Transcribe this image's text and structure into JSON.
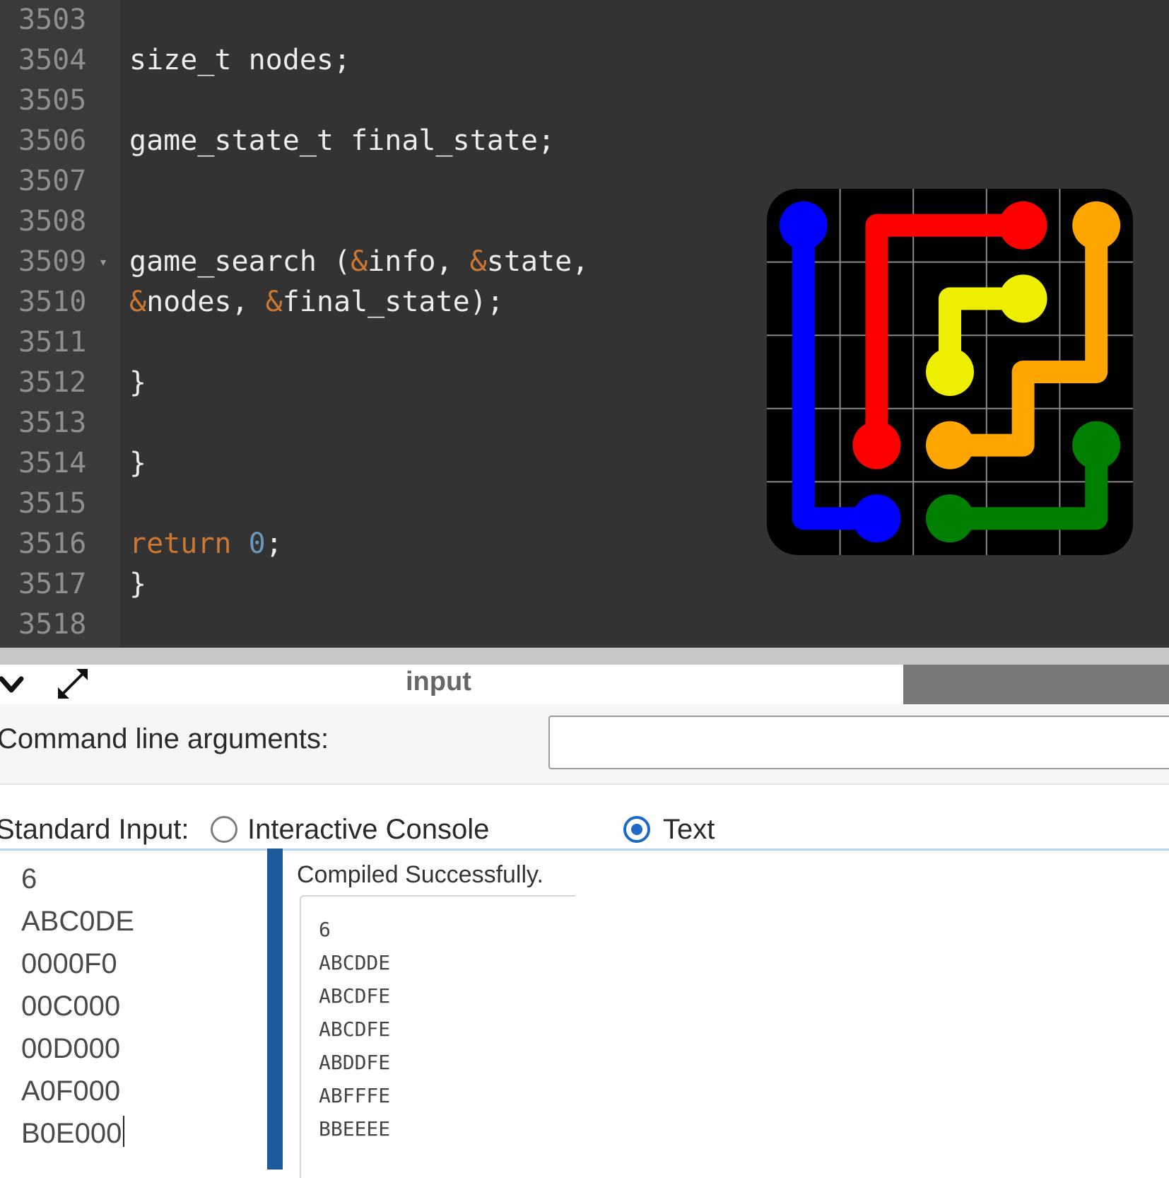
{
  "editor": {
    "lines": [
      {
        "num": "3503",
        "code": ""
      },
      {
        "num": "3504",
        "code": "size_t nodes;"
      },
      {
        "num": "3505",
        "code": ""
      },
      {
        "num": "3506",
        "code": "game_state_t final_state;"
      },
      {
        "num": "3507",
        "code": ""
      },
      {
        "num": "3508",
        "code": ""
      },
      {
        "num": "3509",
        "fold": "▾",
        "code_parts": [
          "game_search (",
          "&",
          "info, ",
          "&",
          "state,"
        ]
      },
      {
        "num": "3510",
        "code_parts": [
          "&",
          "nodes, ",
          "&",
          "final_state);"
        ]
      },
      {
        "num": "3511",
        "code": ""
      },
      {
        "num": "3512",
        "code": "}"
      },
      {
        "num": "3513",
        "code": ""
      },
      {
        "num": "3514",
        "code": "}"
      },
      {
        "num": "3515",
        "code": ""
      },
      {
        "num": "3516",
        "code_parts": [
          "return",
          " ",
          "0",
          ";"
        ]
      },
      {
        "num": "3517",
        "code": "}"
      },
      {
        "num": "3518",
        "code": ""
      }
    ]
  },
  "game_board": {
    "grid_size": 5,
    "colors": {
      "blue": "#0000ff",
      "red": "#ff0000",
      "orange": "#ffa500",
      "yellow": "#eeee00",
      "green": "#008000",
      "board": "#000000",
      "grid": "#8a8a8a"
    },
    "flows": [
      {
        "color": "blue",
        "path": [
          [
            0,
            0
          ],
          [
            0,
            1
          ],
          [
            0,
            2
          ],
          [
            0,
            3
          ],
          [
            0,
            4
          ],
          [
            1,
            4
          ]
        ]
      },
      {
        "color": "red",
        "path": [
          [
            3,
            0
          ],
          [
            2,
            0
          ],
          [
            1,
            0
          ],
          [
            1,
            1
          ],
          [
            1,
            2
          ],
          [
            1,
            3
          ]
        ]
      },
      {
        "color": "orange",
        "path": [
          [
            4,
            0
          ],
          [
            4,
            1
          ],
          [
            4,
            2
          ],
          [
            3,
            2
          ],
          [
            3,
            3
          ],
          [
            2,
            3
          ]
        ]
      },
      {
        "color": "yellow",
        "path": [
          [
            3,
            1
          ],
          [
            2,
            1
          ],
          [
            2,
            2
          ]
        ]
      },
      {
        "color": "green",
        "path": [
          [
            4,
            3
          ],
          [
            4,
            4
          ],
          [
            3,
            4
          ],
          [
            2,
            4
          ]
        ]
      }
    ]
  },
  "panel": {
    "title": "input",
    "collapse_icon": "chevron-down-icon",
    "expand_icon": "expand-arrows-icon"
  },
  "args": {
    "label": "Command line arguments:",
    "value": ""
  },
  "stdin": {
    "label": "Standard Input:",
    "options": [
      "Interactive Console",
      "Text"
    ],
    "selected": "Text",
    "lines": [
      "6",
      "ABC0DE",
      "0000F0",
      "00C000",
      "00D000",
      "A0F000",
      "B0E000"
    ]
  },
  "output": {
    "status": "Compiled Successfully. ",
    "lines": [
      "6",
      "ABCDDE",
      "ABCDFE",
      "ABCDFE",
      "ABDDFE",
      "ABFFFE",
      "BBEEEE"
    ]
  }
}
